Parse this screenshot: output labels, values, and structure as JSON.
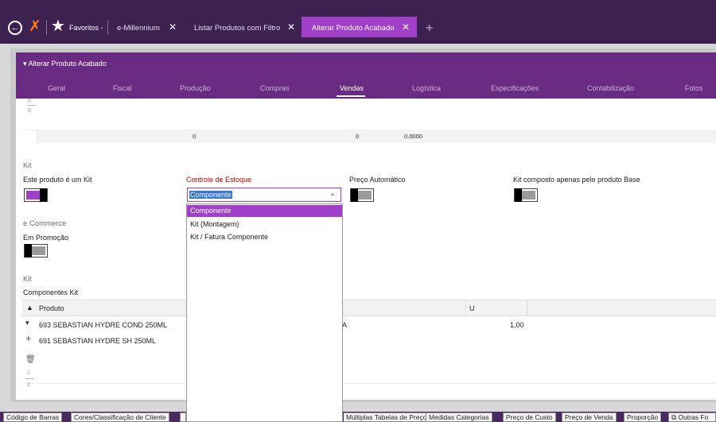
{
  "topbar": {
    "favorites": "Favoritos -",
    "tabs": [
      "e-Millennium",
      "Listar Produtos com Filtro",
      "Alterar Produto Acabado"
    ]
  },
  "panel": {
    "title": "Alterar Produto Acabado",
    "tabs": [
      "Geral",
      "Fiscal",
      "Produção",
      "Compras",
      "Vendas",
      "Logística",
      "Especificações",
      "Contabilização",
      "Fotos"
    ],
    "active_tab": "Vendas"
  },
  "upper_table": {
    "ruler": [
      "0",
      "0"
    ],
    "totals": [
      "0",
      "0",
      "0.0000"
    ]
  },
  "kit": {
    "section": "Kit",
    "is_kit_label": "Este produto é um Kit",
    "stock_control_label": "Controle de Estoque",
    "stock_control_value": "Componente",
    "auto_price_label": "Preço Automático",
    "base_only_label": "Kit composto apenas pelo produto Base"
  },
  "dropdown": {
    "options": [
      "Componente",
      "Kit (Montagem)",
      "Kit / Fatura Componente"
    ]
  },
  "ecommerce": {
    "section": "e Commerce",
    "promo_label": "Em Promoção"
  },
  "components": {
    "section": "Kit",
    "title": "Componentes Kit",
    "columns": [
      "Produto",
      "U"
    ],
    "rows": [
      {
        "product": "693 SEBASTIAN HYDRE COND 250ML",
        "col2": "A",
        "qty": "1,00"
      },
      {
        "product": "691 SEBASTIAN HYDRE SH 250ML"
      }
    ],
    "row_numbers": [
      "1",
      "2"
    ]
  },
  "bottom_tabs": [
    "Código de Barras",
    "Cores/Classificação de Cliente",
    "Múltiplas Tabelas de Preço",
    "Medidas Categorias",
    "Preço de Custo",
    "Preço de Venda",
    "Proporção",
    "Outras Fo"
  ],
  "colors": {
    "purple_dark": "#3d2150",
    "purple_header": "#6a2c83",
    "accent": "#a040c8",
    "orange": "#ff7a1a"
  }
}
